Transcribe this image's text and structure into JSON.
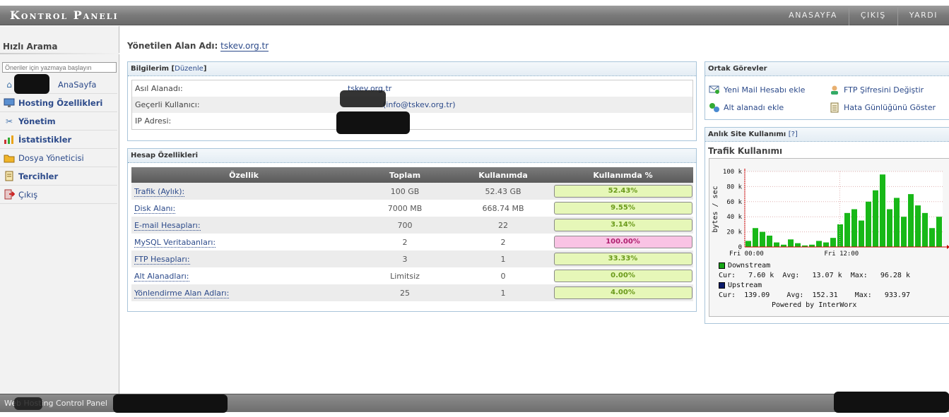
{
  "header": {
    "brand": "Kontrol Paneli",
    "nav": [
      "ANASAYFA",
      "ÇIKIŞ",
      "YARDI"
    ]
  },
  "sidebar": {
    "title": "Hızlı Arama",
    "search_placeholder": "Öneriler için yazmaya başlayın",
    "items": [
      {
        "label": "AnaSayfa",
        "icon": "home-icon",
        "bold": false
      },
      {
        "label": "Hosting Özellikleri",
        "icon": "monitor-icon",
        "bold": true
      },
      {
        "label": "Yönetim",
        "icon": "tools-icon",
        "bold": true
      },
      {
        "label": "İstatistikler",
        "icon": "chart-icon",
        "bold": true
      },
      {
        "label": "Dosya Yöneticisi",
        "icon": "folder-icon",
        "bold": false
      },
      {
        "label": "Tercihler",
        "icon": "notebook-icon",
        "bold": true
      },
      {
        "label": "Çıkış",
        "icon": "exit-icon",
        "bold": false
      }
    ]
  },
  "main": {
    "domain_label": "Yönetilen Alan Adı:",
    "domain_value": "tskev.org.tr",
    "bilgilerim": {
      "title": "Bilgilerim",
      "edit": "Düzenle",
      "rows": [
        {
          "key": "Asıl Alanadı:",
          "value": "tskev.org.tr",
          "link": true
        },
        {
          "key": "Geçerli Kullanıcı:",
          "value": "(info@tskev.org.tr)",
          "link": true
        },
        {
          "key": "IP Adresi:",
          "value": "",
          "link": false
        }
      ]
    },
    "hesap": {
      "title": "Hesap Özellikleri",
      "headers": [
        "Özellik",
        "Toplam",
        "Kullanımda",
        "Kullanımda %"
      ],
      "rows": [
        {
          "name": "Trafik (Aylık):",
          "total": "100 GB",
          "used": "52.43 GB",
          "pct": "52.43%",
          "full": false
        },
        {
          "name": "Disk Alanı:",
          "total": "7000 MB",
          "used": "668.74 MB",
          "pct": "9.55%",
          "full": false
        },
        {
          "name": "E-mail Hesapları:",
          "total": "700",
          "used": "22",
          "pct": "3.14%",
          "full": false
        },
        {
          "name": "MySQL Veritabanları:",
          "total": "2",
          "used": "2",
          "pct": "100.00%",
          "full": true
        },
        {
          "name": "FTP Hesapları:",
          "total": "3",
          "used": "1",
          "pct": "33.33%",
          "full": false
        },
        {
          "name": "Alt Alanadları:",
          "total": "Limitsiz",
          "used": "0",
          "pct": "0.00%",
          "full": false
        },
        {
          "name": "Yönlendirme Alan Adları:",
          "total": "25",
          "used": "1",
          "pct": "4.00%",
          "full": false
        }
      ]
    }
  },
  "right": {
    "ortak": {
      "title": "Ortak Görevler",
      "tasks": [
        {
          "label": "Yeni Mail Hesabı ekle",
          "icon": "mail-add-icon"
        },
        {
          "label": "FTP Şifresini Değiştir",
          "icon": "user-icon"
        },
        {
          "label": "Alt alanadı ekle",
          "icon": "puzzle-icon"
        },
        {
          "label": "Hata Günlüğünü Göster",
          "icon": "log-icon"
        }
      ]
    },
    "usage": {
      "title": "Anlık Site Kullanımı",
      "help": "[?]",
      "subtitle": "Trafik Kullanımı",
      "legend": {
        "downstream": {
          "name": "Downstream",
          "cur": "7.60 k",
          "avg": "13.07 k",
          "max": "96.28 k",
          "color": "#16a516"
        },
        "upstream": {
          "name": "Upstream",
          "cur": "139.09",
          "avg": "152.31",
          "max": "933.97",
          "color": "#0a1a6a"
        },
        "cur_label": "Cur:",
        "avg_label": "Avg:",
        "max_label": "Max:",
        "powered": "Powered by InterWorx"
      }
    }
  },
  "footer": {
    "text": "Web Hosting Control Panel"
  },
  "chart_data": {
    "type": "area",
    "title": "",
    "xlabel": "",
    "ylabel": "bytes / sec",
    "y_ticks": [
      "0",
      "20 k",
      "40 k",
      "60 k",
      "80 k",
      "100 k"
    ],
    "ylim": [
      0,
      100000
    ],
    "x_ticks": [
      "Fri 00:00",
      "Fri 12:00"
    ],
    "series": [
      {
        "name": "Downstream",
        "peaks": [
          8000,
          25000,
          20000,
          15000,
          6000,
          3000,
          10000,
          5000,
          2000,
          3000,
          8000,
          6000,
          12000,
          30000,
          45000,
          50000,
          35000,
          60000,
          75000,
          96000,
          50000,
          65000,
          40000,
          70000,
          55000,
          45000,
          25000,
          40000
        ]
      },
      {
        "name": "Upstream",
        "peaks": [
          139,
          150,
          160,
          140,
          130,
          150,
          170,
          145,
          140,
          150,
          160,
          155,
          170,
          200,
          250,
          300,
          260,
          400,
          600,
          934,
          500,
          420,
          300,
          500,
          350,
          260,
          200,
          250
        ]
      }
    ]
  }
}
